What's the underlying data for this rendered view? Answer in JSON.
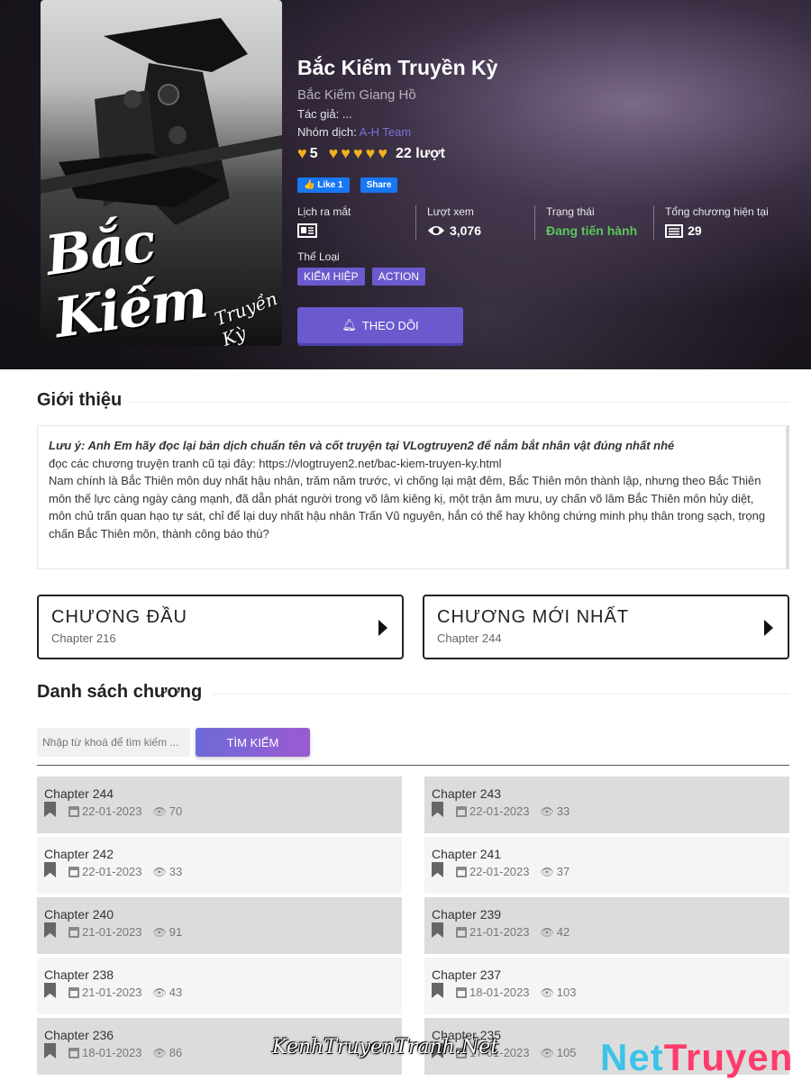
{
  "manga": {
    "title": "Bắc Kiếm Truyền Kỳ",
    "alt_title": "Bắc Kiếm Giang Hồ",
    "author_label": "Tác giả:",
    "author": "...",
    "team_label": "Nhóm dịch:",
    "team": "A-H Team",
    "rating_score": "5",
    "rating_count": "22 lượt",
    "rating_stars": 5,
    "cover_title": "Bắc Kiếm",
    "cover_subtitle": "Truyền Kỳ"
  },
  "social": {
    "like_label": "Like 1",
    "share_label": "Share"
  },
  "stats": {
    "release_label": "Lịch ra mắt",
    "views_label": "Lượt xem",
    "views_value": "3,076",
    "status_label": "Trạng thái",
    "status_value": "Đang tiến hành",
    "chapters_label": "Tổng chương hiện tại",
    "chapters_value": "29"
  },
  "genres": {
    "label": "Thể Loại",
    "items": [
      "KIẾM HIỆP",
      "ACTION"
    ]
  },
  "follow_label": "THEO DÕI",
  "intro": {
    "heading": "Giới thiệu",
    "note": "Lưu ý: Anh Em hãy đọc lại bản dịch chuẩn tên và cốt truyện tại VLogtruyen2 để nắm bắt nhân vật đúng nhất nhé",
    "old_link": "đọc các chương truyện tranh cũ tại đây: https://vlogtruyen2.net/bac-kiem-truyen-ky.html",
    "summary": "Nam chính là Bắc Thiên môn duy nhất hậu nhân, trăm năm trước, vì chống lại mật đêm, Bắc Thiên môn thành lập, nhưng theo Bắc Thiên môn thế lực càng ngày càng mạnh, đã dẫn phát người trong võ lâm kiêng kị, một trận âm mưu, uy chấn võ lâm Bắc Thiên môn hủy diệt, môn chủ trấn quan hạo tự sát, chỉ để lại duy nhất hậu nhân Trấn Vũ nguyên, hắn có thể hay không chứng minh phụ thân trong sạch, trọng chấn Bắc Thiên môn, thành công báo thù?"
  },
  "first_chapter": {
    "label": "CHƯƠNG ĐẦU",
    "chapter": "Chapter 216"
  },
  "latest_chapter": {
    "label": "CHƯƠNG MỚI NHẤT",
    "chapter": "Chapter 244"
  },
  "chapter_list": {
    "heading": "Danh sách chương",
    "search_placeholder": "Nhập từ khoá để tìm kiếm ...",
    "search_button": "TÌM KIẾM",
    "items": [
      {
        "name": "Chapter 244",
        "date": "22-01-2023",
        "views": "70"
      },
      {
        "name": "Chapter 243",
        "date": "22-01-2023",
        "views": "33"
      },
      {
        "name": "Chapter 242",
        "date": "22-01-2023",
        "views": "33"
      },
      {
        "name": "Chapter 241",
        "date": "22-01-2023",
        "views": "37"
      },
      {
        "name": "Chapter 240",
        "date": "21-01-2023",
        "views": "91"
      },
      {
        "name": "Chapter 239",
        "date": "21-01-2023",
        "views": "42"
      },
      {
        "name": "Chapter 238",
        "date": "21-01-2023",
        "views": "43"
      },
      {
        "name": "Chapter 237",
        "date": "18-01-2023",
        "views": "103"
      },
      {
        "name": "Chapter 236",
        "date": "18-01-2023",
        "views": "86"
      },
      {
        "name": "Chapter 235",
        "date": "17-01-2023",
        "views": "105"
      }
    ]
  },
  "watermarks": {
    "left": "KenhTruyenTranh.Net",
    "right_a": "Net",
    "right_b": "Truyen"
  },
  "colors": {
    "accent": "#6a5acd",
    "status_green": "#5dc65d",
    "heart": "#f2b01e"
  }
}
